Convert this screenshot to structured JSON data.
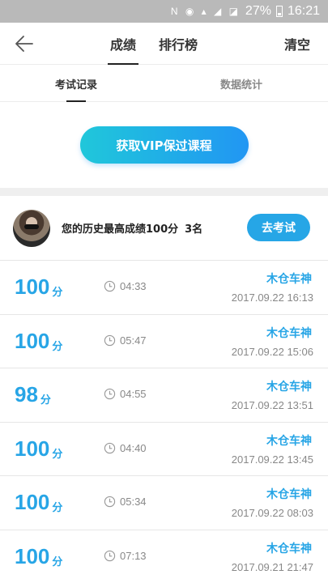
{
  "status_bar": {
    "battery": "27%",
    "time": "16:21",
    "network": "4G"
  },
  "nav": {
    "tabs": [
      {
        "label": "成绩",
        "active": true
      },
      {
        "label": "排行榜",
        "active": false
      }
    ],
    "clear_label": "清空"
  },
  "sub_tabs": [
    {
      "label": "考试记录",
      "active": true
    },
    {
      "label": "数据统计",
      "active": false
    }
  ],
  "vip_button": "获取VIP保过课程",
  "best": {
    "text": "您的历史最高成绩100分",
    "rank": "3名",
    "go_exam_label": "去考试"
  },
  "records": [
    {
      "score": "100",
      "unit": "分",
      "duration": "04:33",
      "user": "木仓车神",
      "date": "2017.09.22  16:13"
    },
    {
      "score": "100",
      "unit": "分",
      "duration": "05:47",
      "user": "木仓车神",
      "date": "2017.09.22  15:06"
    },
    {
      "score": "98",
      "unit": "分",
      "duration": "04:55",
      "user": "木仓车神",
      "date": "2017.09.22  13:51"
    },
    {
      "score": "100",
      "unit": "分",
      "duration": "04:40",
      "user": "木仓车神",
      "date": "2017.09.22  13:45"
    },
    {
      "score": "100",
      "unit": "分",
      "duration": "05:34",
      "user": "木仓车神",
      "date": "2017.09.22  08:03"
    },
    {
      "score": "100",
      "unit": "分",
      "duration": "07:13",
      "user": "木仓车神",
      "date": "2017.09.21  21:47"
    }
  ],
  "colors": {
    "accent": "#27a5e6",
    "gradient_start": "#20c7da",
    "gradient_end": "#2196f3"
  }
}
